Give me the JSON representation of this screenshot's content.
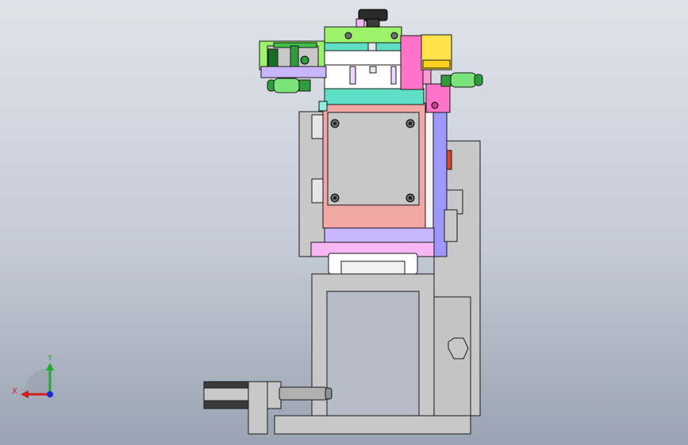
{
  "axis_triad": {
    "x_label": "X",
    "y_label": "Y",
    "x_color": "#d21e1e",
    "y_color": "#1eae2c",
    "z_color": "#1d2bd6"
  },
  "palette": {
    "body_gray": "#c8c8c8",
    "pink": "#f2a7a5",
    "teal": "#5fe0c6",
    "lime": "#9cf36a",
    "violet": "#b68cf2",
    "light_purple": "#c9b4ff",
    "slate_blue": "#9d98ff",
    "magenta": "#ff73c9",
    "light_pink": "#f6b6f3",
    "yellow": "#ffe24d",
    "green_fitting": "#2e9d3a",
    "knob": "#2a2a2a"
  }
}
